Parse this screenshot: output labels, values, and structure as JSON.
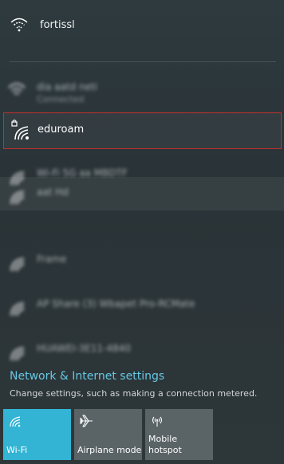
{
  "networks": {
    "connected": {
      "name": "fortissl",
      "icon": "wifi-connected-icon"
    },
    "blurred_1": {
      "name": "dia aatd neti",
      "status": "Connected"
    },
    "selected": {
      "name": "eduroam",
      "icon": "wifi-secured-icon"
    },
    "blurred_2": {
      "name": "Wi-Fi 5G aa MBDTF"
    },
    "blurred_3": {
      "name": "aat Hd"
    },
    "blurred_4": {
      "name": "Frame"
    },
    "blurred_5": {
      "name": "AP Share (3) Wbapet Pro-RCMate"
    },
    "blurred_6": {
      "name": "HUAWEI-3E11-4840"
    }
  },
  "settings": {
    "link_label": "Network & Internet settings",
    "description": "Change settings, such as making a connection metered."
  },
  "quick_actions": [
    {
      "label": "Wi-Fi",
      "icon": "wifi-icon",
      "active": true
    },
    {
      "label": "Airplane mode",
      "icon": "airplane-icon",
      "active": false
    },
    {
      "label": "Mobile\nhotspot",
      "icon": "hotspot-icon",
      "active": false
    }
  ],
  "colors": {
    "accent": "#33b4d4",
    "link": "#66c7e3",
    "selection_border": "#c0312f",
    "tile_inactive": "#5a6366"
  }
}
